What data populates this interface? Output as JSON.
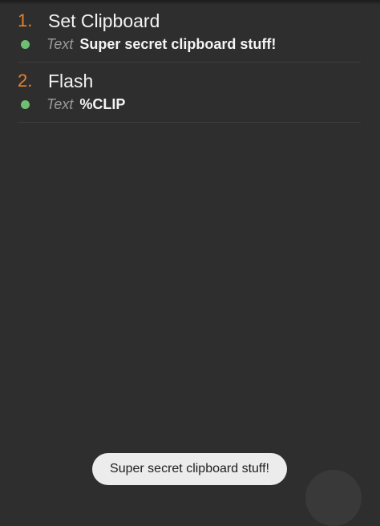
{
  "actions": [
    {
      "number": "1.",
      "title": "Set Clipboard",
      "param_label": "Text",
      "param_value": "Super secret clipboard stuff!"
    },
    {
      "number": "2.",
      "title": "Flash",
      "param_label": "Text",
      "param_value": "%CLIP"
    }
  ],
  "toast": {
    "text": "Super secret clipboard stuff!"
  },
  "colors": {
    "background": "#2e2e2e",
    "action_number": "#e8812a",
    "status_dot": "#6fbf73",
    "toast_background": "#ececec"
  }
}
